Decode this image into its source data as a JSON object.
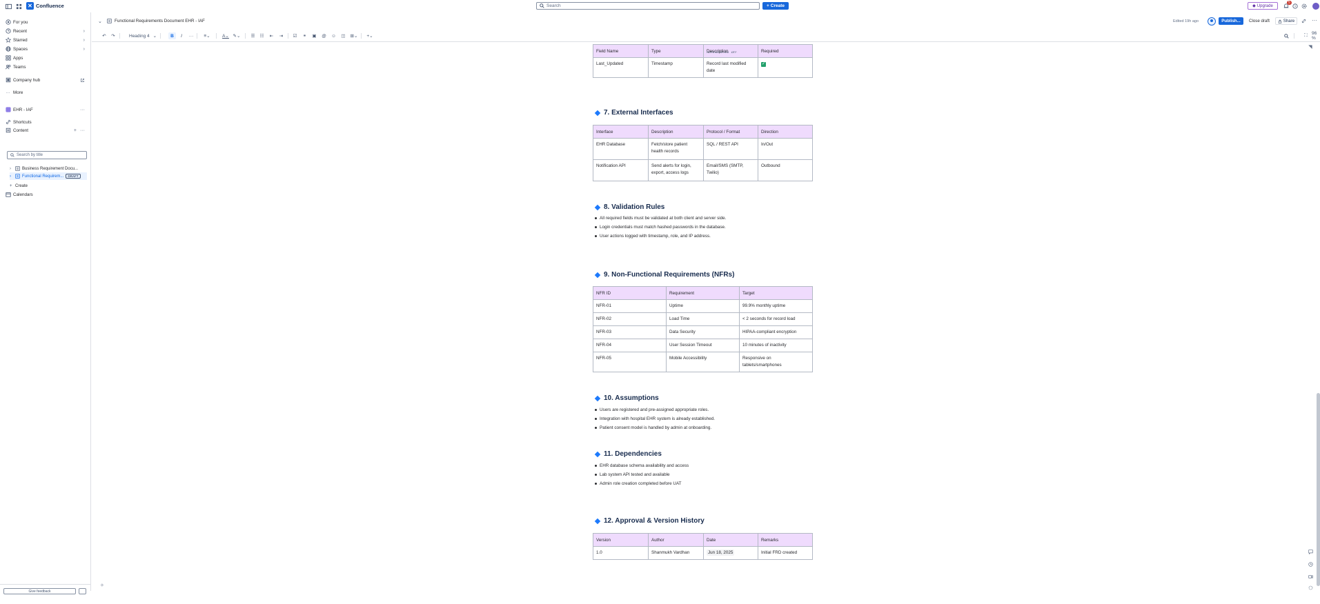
{
  "app": {
    "name": "Confluence"
  },
  "topbar": {
    "search_placeholder": "Search",
    "create_label": "Create",
    "upgrade_label": "Upgrade",
    "notification_count": "5"
  },
  "sidebar": {
    "nav": [
      {
        "label": "For you",
        "icon": "for-you-icon"
      },
      {
        "label": "Recent",
        "icon": "clock-icon"
      },
      {
        "label": "Starred",
        "icon": "star-icon"
      },
      {
        "label": "Spaces",
        "icon": "globe-icon"
      },
      {
        "label": "Apps",
        "icon": "apps-icon"
      },
      {
        "label": "Teams",
        "icon": "teams-icon"
      },
      {
        "label": "Company hub",
        "icon": "company-hub-icon"
      },
      {
        "label": "More",
        "icon": "more-icon"
      }
    ],
    "space_name": "EHR - IAF",
    "space_links": [
      {
        "label": "Shortcuts",
        "icon": "link-icon"
      },
      {
        "label": "Content",
        "icon": "content-icon"
      }
    ],
    "search_placeholder": "Search by title",
    "tree": [
      {
        "label": "Business Requirement Docu..."
      },
      {
        "label": "Functional Requirem...",
        "badge": "DRAFT"
      }
    ],
    "create_label": "Create",
    "calendars_label": "Calendars",
    "footer_label": "Give feedback"
  },
  "page": {
    "title": "Functional Requirements Document EHR - IAF",
    "edited": "Edited 19h ago",
    "publish_label": "Publish...",
    "close_draft_label": "Close draft",
    "share_label": "Share"
  },
  "toolbar": {
    "text_style": "Heading 4",
    "bold": "B",
    "italic": "I",
    "zoom": "96 %"
  },
  "sections": {
    "fields_table": {
      "headers": [
        "Field Name",
        "Type",
        "Description",
        "Required"
      ],
      "rows": [
        [
          "Last_Updated",
          "Timestamp",
          "Record last modified date",
          "✓"
        ]
      ],
      "clipped_fragment": "temperature, etc."
    },
    "s7": {
      "heading": "7. External Interfaces",
      "headers": [
        "Interface",
        "Description",
        "Protocol / Format",
        "Direction"
      ],
      "rows": [
        [
          "EHR Database",
          "Fetch/store patient health records",
          "SQL / REST API",
          "In/Out"
        ],
        [
          "Notification API",
          "Send alerts for login, export, access logs",
          "Email/SMS (SMTP, Twilio)",
          "Outbound"
        ]
      ]
    },
    "s8": {
      "heading": "8. Validation Rules",
      "bullets": [
        "All required fields must be validated at both client and server side.",
        "Login credentials must match hashed passwords in the database.",
        "User actions logged with timestamp, role, and IP address."
      ]
    },
    "s9": {
      "heading": "9. Non-Functional Requirements (NFRs)",
      "headers": [
        "NFR ID",
        "Requirement",
        "Target"
      ],
      "rows": [
        [
          "NFR-01",
          "Uptime",
          "99.9% monthly uptime"
        ],
        [
          "NFR-02",
          "Load Time",
          "< 2 seconds for record load"
        ],
        [
          "NFR-03",
          "Data Security",
          "HIPAA-compliant encryption"
        ],
        [
          "NFR-04",
          "User Session Timeout",
          "10 minutes of inactivity"
        ],
        [
          "NFR-05",
          "Mobile Accessibility",
          "Responsive on tablets/smartphones"
        ]
      ]
    },
    "s10": {
      "heading": "10. Assumptions",
      "bullets": [
        "Users are registered and pre-assigned appropriate roles.",
        "Integration with hospital EHR system is already established.",
        "Patient consent model is handled by admin at onboarding."
      ]
    },
    "s11": {
      "heading": "11. Dependencies",
      "bullets": [
        "EHR database schema availability and access",
        "Lab system API tested and available",
        "Admin role creation completed before UAT"
      ]
    },
    "s12": {
      "heading": "12. Approval & Version History",
      "headers": [
        "Version",
        "Author",
        "Date",
        "Remarks"
      ],
      "rows": [
        [
          "1.0",
          "Shanmukh Vardhan",
          "Jun 18, 2025",
          "Initial FRD created"
        ]
      ]
    }
  },
  "colors": {
    "accent": "#1868db",
    "table_header": "#efdbfd",
    "heading_marker": "#1d7afc"
  }
}
